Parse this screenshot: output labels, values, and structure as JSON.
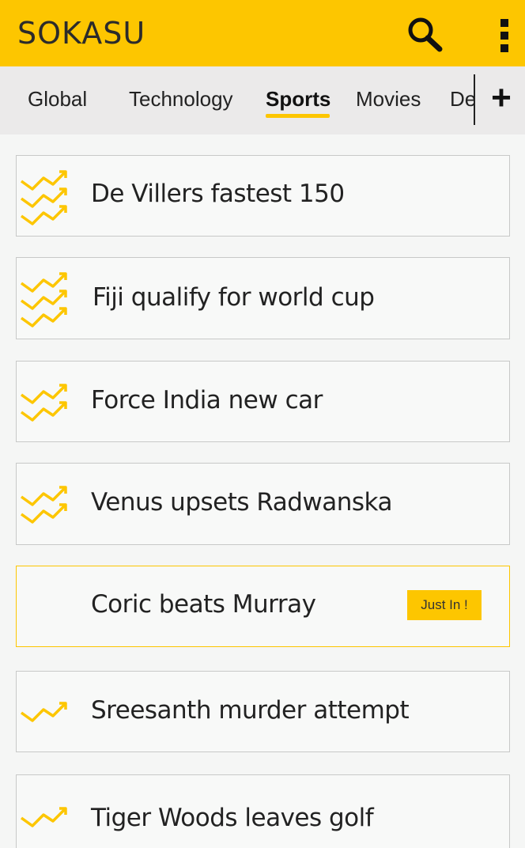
{
  "app": {
    "title": "SOKASU",
    "colors": {
      "accent": "#fdc600",
      "background": "#f5f6f5",
      "tabbar": "#ebeaea"
    },
    "icons": {
      "search": "search-icon",
      "menu": "more-vert-icon",
      "add": "plus-icon",
      "trend": "trending-up-icon"
    }
  },
  "tabs": [
    {
      "label": "Global",
      "active": false
    },
    {
      "label": "Technology",
      "active": false
    },
    {
      "label": "Sports",
      "active": true
    },
    {
      "label": "Movies",
      "active": false
    },
    {
      "label": "De",
      "active": false
    }
  ],
  "add_tab_label": "+",
  "news": [
    {
      "title": "De Villers fastest 150",
      "trend_level": 3,
      "badge": ""
    },
    {
      "title": "Fiji qualify for world cup",
      "trend_level": 3,
      "badge": ""
    },
    {
      "title": "Force India new car",
      "trend_level": 2,
      "badge": ""
    },
    {
      "title": "Venus upsets Radwanska",
      "trend_level": 2,
      "badge": ""
    },
    {
      "title": "Coric beats Murray",
      "trend_level": 0,
      "badge": "Just In !"
    },
    {
      "title": "Sreesanth murder attempt",
      "trend_level": 1,
      "badge": ""
    },
    {
      "title": "Tiger Woods leaves golf",
      "trend_level": 1,
      "badge": ""
    }
  ]
}
